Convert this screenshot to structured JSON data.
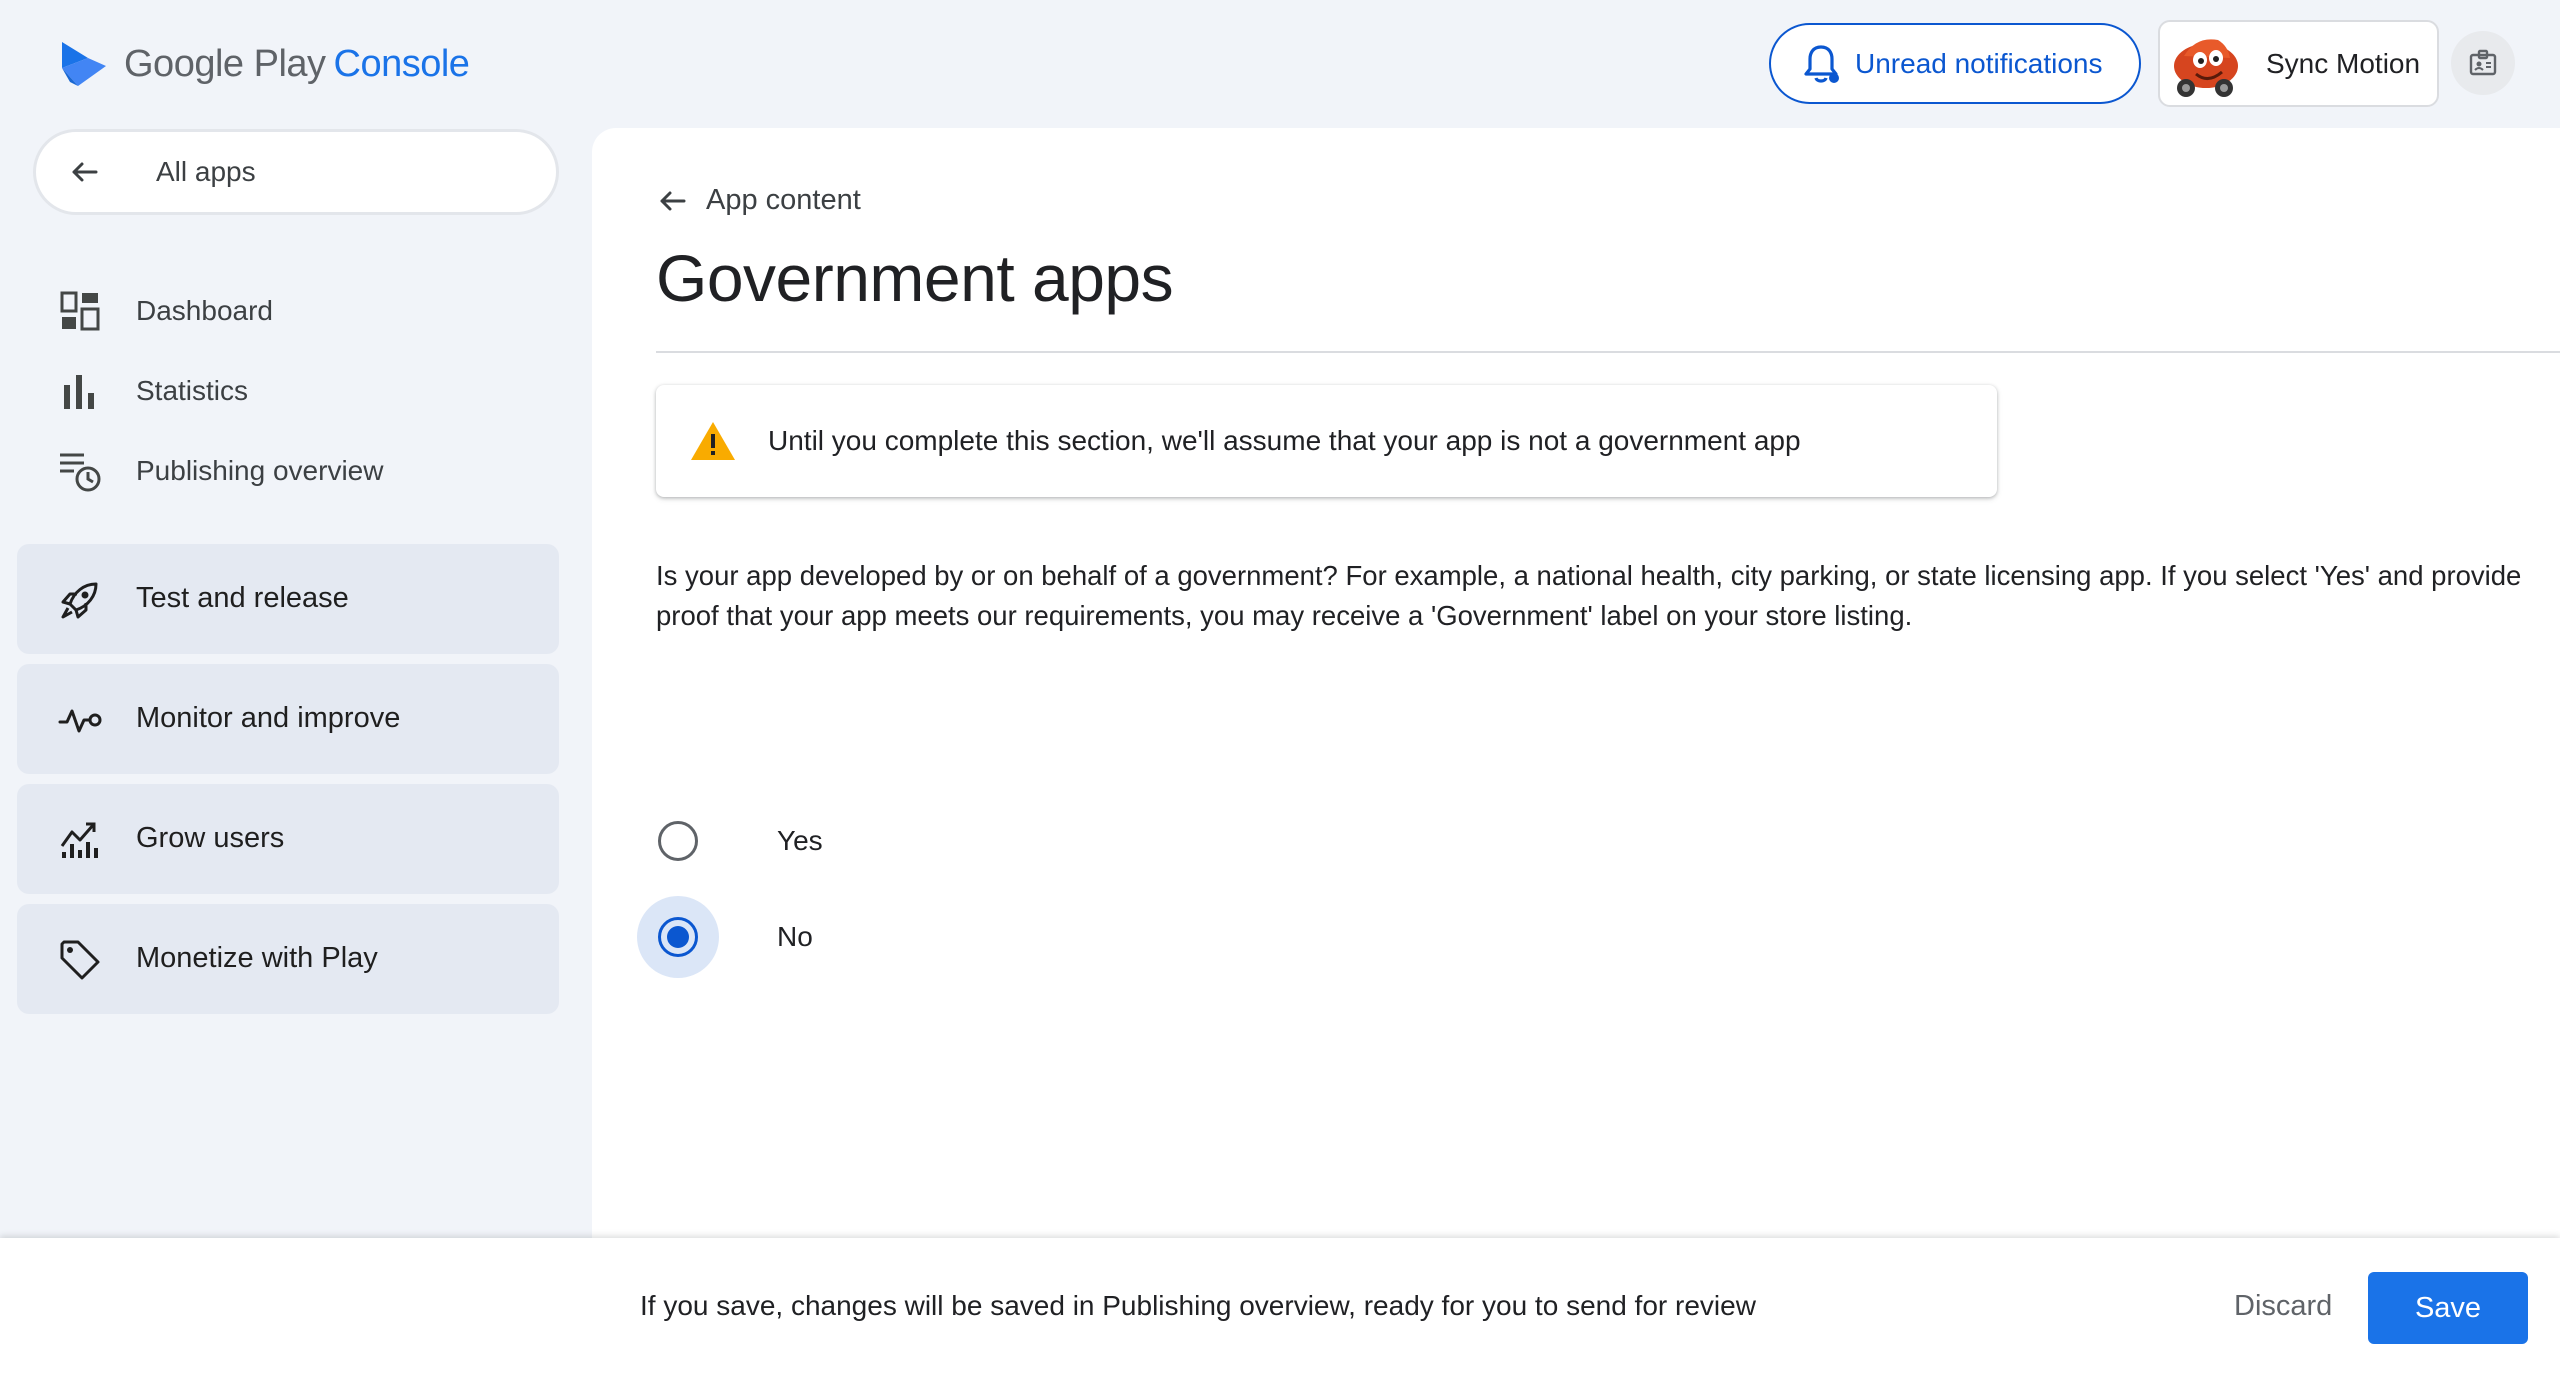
{
  "header": {
    "logo_primary": "Google Play",
    "logo_secondary": "Console",
    "notifications_label": "Unread notifications",
    "account_name": "Sync Motion"
  },
  "sidebar": {
    "all_apps": "All apps",
    "items": [
      {
        "label": "Dashboard",
        "icon": "dashboard-icon"
      },
      {
        "label": "Statistics",
        "icon": "bar-chart-icon"
      },
      {
        "label": "Publishing overview",
        "icon": "publishing-history-icon"
      }
    ],
    "sections": [
      {
        "label": "Test and release",
        "icon": "rocket-icon"
      },
      {
        "label": "Monitor and improve",
        "icon": "vitals-icon"
      },
      {
        "label": "Grow users",
        "icon": "growth-icon"
      },
      {
        "label": "Monetize with Play",
        "icon": "tag-icon"
      }
    ]
  },
  "main": {
    "back_label": "App content",
    "title": "Government apps",
    "warning": "Until you complete this section, we'll assume that your app is not a government app",
    "question": "Is your app developed by or on behalf of a government? For example, a national health, city parking, or state licensing app. If you select 'Yes' and provide proof that your app meets our requirements, you may receive a 'Government' label on your store listing.",
    "options": [
      {
        "label": "Yes",
        "selected": false
      },
      {
        "label": "No",
        "selected": true
      }
    ]
  },
  "footer": {
    "message": "If you save, changes will be saved in Publishing overview, ready for you to send for review",
    "discard_label": "Discard",
    "save_label": "Save"
  },
  "colors": {
    "accent": "#1a73e8",
    "selected_radio": "#0b57d0",
    "warning": "#f9ab00",
    "sidebar_section_bg": "#e4e9f2"
  }
}
